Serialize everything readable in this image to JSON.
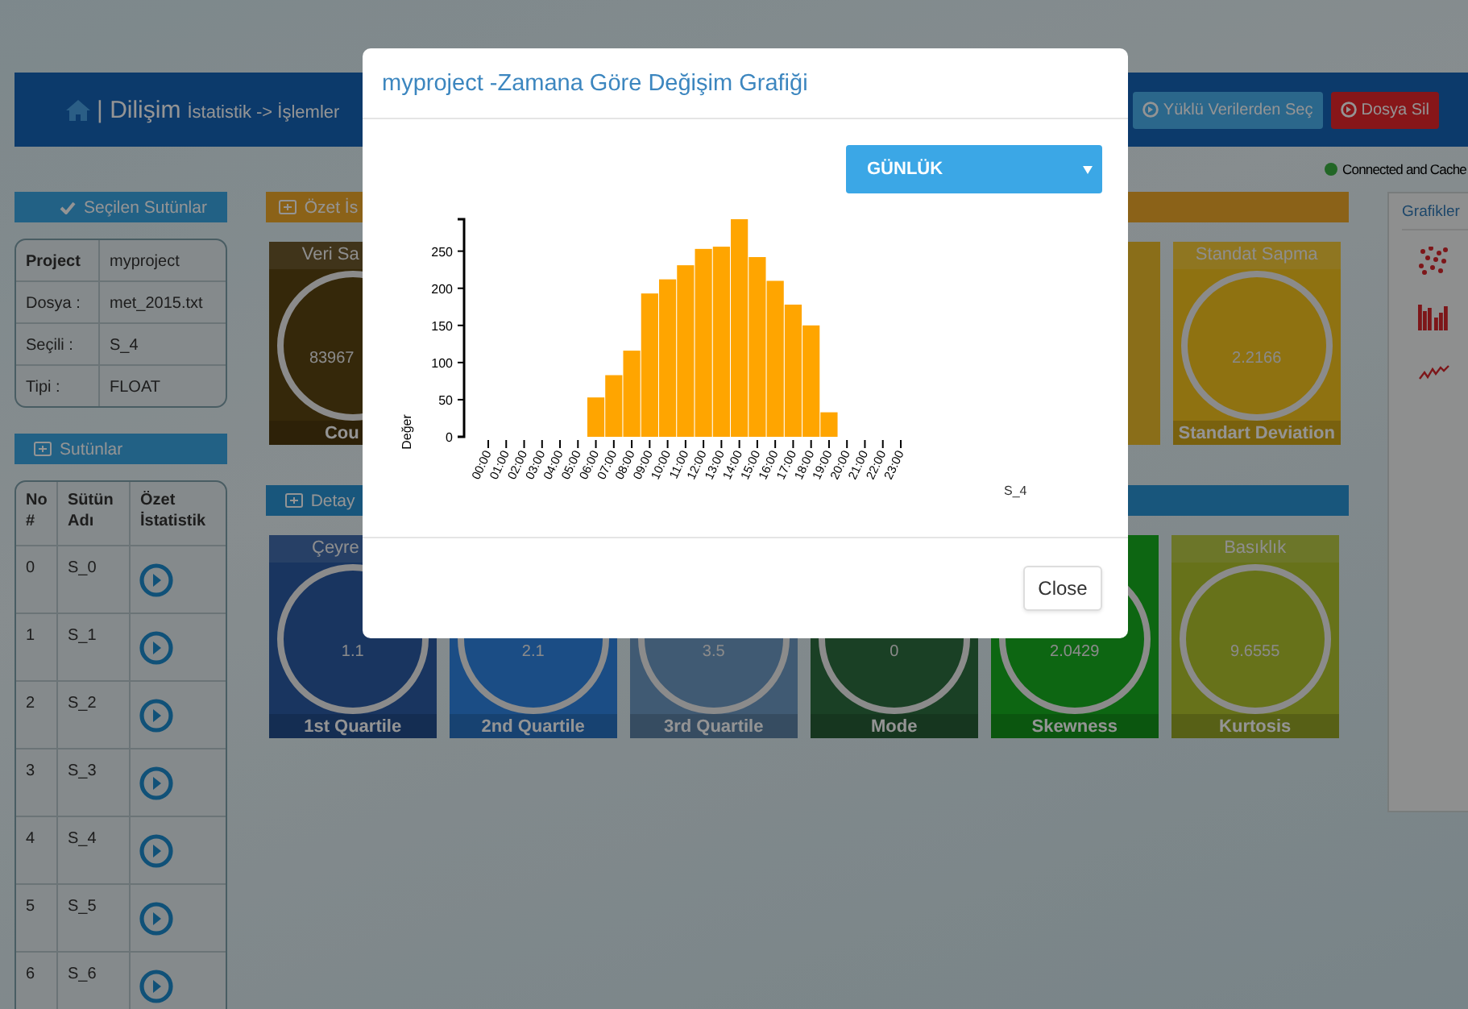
{
  "header": {
    "brand": "| Dilişim",
    "breadcrumb": "İstatistik -> İşlemler",
    "buttons": [
      {
        "label": "Yüklü Verilerden Seç",
        "kind": "primary"
      },
      {
        "label": "Dosya Sil",
        "kind": "danger"
      }
    ]
  },
  "status": {
    "text": "Connected and Cache"
  },
  "selected_panel": {
    "title": "Seçilen Sutünlar",
    "rows": [
      {
        "label": "Project",
        "value": "myproject",
        "bold": true
      },
      {
        "label": "Dosya :",
        "value": "met_2015.txt",
        "bold": false
      },
      {
        "label": "Seçili :",
        "value": "S_4",
        "bold": false
      },
      {
        "label": "Tipi :",
        "value": "FLOAT",
        "bold": false
      }
    ]
  },
  "columns_panel": {
    "title": "Sutünlar",
    "headers": [
      "No #",
      "Sütün Adı",
      "Özet İstatistik"
    ],
    "rows": [
      {
        "no": "0",
        "name": "S_0"
      },
      {
        "no": "1",
        "name": "S_1"
      },
      {
        "no": "2",
        "name": "S_2"
      },
      {
        "no": "3",
        "name": "S_3"
      },
      {
        "no": "4",
        "name": "S_4"
      },
      {
        "no": "5",
        "name": "S_5"
      },
      {
        "no": "6",
        "name": "S_6"
      }
    ]
  },
  "summary_section": {
    "title": "Özet İs",
    "cards": [
      {
        "kind": "cut",
        "title": "Veri Sa",
        "value": "83967",
        "label": "Cou"
      },
      {
        "kind": "covered"
      },
      {
        "kind": "stat",
        "title": "Standat Sapma",
        "value": "2.2166",
        "label": "Standart Deviation"
      }
    ]
  },
  "detail_section": {
    "title": "Detay",
    "cards": [
      {
        "kind": "cut-title",
        "title": "Çeyre",
        "value": "1.1",
        "label": "1st Quartile"
      },
      {
        "kind": "stat",
        "value": "2.1",
        "label": "2nd Quartile"
      },
      {
        "kind": "stat",
        "value": "3.5",
        "label": "3rd Quartile"
      },
      {
        "kind": "stat",
        "value": "0",
        "label": "Mode"
      },
      {
        "kind": "stat",
        "value": "2.0429",
        "label": "Skewness"
      },
      {
        "kind": "stat",
        "title": "Basıklık",
        "value": "9.6555",
        "label": "Kurtosis"
      }
    ]
  },
  "charts_panel": {
    "title": "Grafikler"
  },
  "modal": {
    "title": "myproject -Zamana Göre Değişim Grafiği",
    "period": "GÜNLÜK",
    "close": "Close",
    "chart_data": {
      "type": "bar",
      "ylabel": "Değer",
      "categories": [
        "00:00",
        "01:00",
        "02:00",
        "03:00",
        "04:00",
        "05:00",
        "06:00",
        "07:00",
        "08:00",
        "09:00",
        "10:00",
        "11:00",
        "12:00",
        "13:00",
        "14:00",
        "15:00",
        "16:00",
        "17:00",
        "18:00",
        "19:00",
        "20:00",
        "21:00",
        "22:00",
        "23:00"
      ],
      "series": [
        {
          "name": "S_4",
          "color": "#ffa500",
          "values": [
            0,
            0,
            0,
            0,
            0,
            0,
            53,
            83,
            116,
            193,
            212,
            231,
            253,
            256,
            293,
            242,
            210,
            178,
            150,
            33,
            0,
            0,
            0,
            0
          ]
        }
      ],
      "ylim": [
        0,
        293
      ],
      "yticks": [
        0,
        50,
        100,
        150,
        200,
        250
      ]
    }
  }
}
